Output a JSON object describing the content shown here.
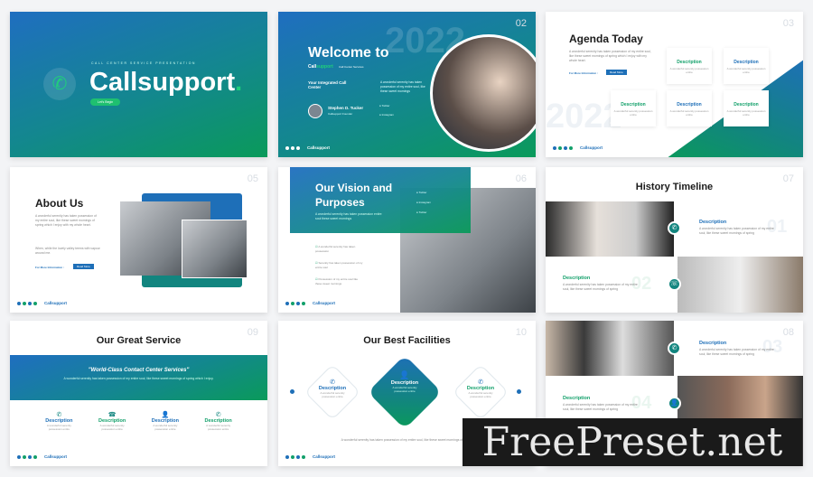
{
  "body_text": "A wonderful serenity has taken possession of my entire soul",
  "footer": {
    "logo": "Callsupport"
  },
  "s1": {
    "subtitle": "CALL CENTER SERVICE PRESENTATION",
    "title": "Callsupport",
    "dot": ".",
    "button": "Let's Begin",
    "icon": "phone-icon"
  },
  "s2": {
    "num": "02",
    "year": "2022",
    "title": "Welcome to",
    "brand_a": "Call",
    "brand_b": "support",
    "tag": "Call Center Services",
    "heading": "Your Integrated Call Center",
    "text": "A wonderful serenity has taken possession of my entire soul, like these sweet mornings",
    "person": "Stephen D. Tucker",
    "role": "Callsupport Founder",
    "social": [
      "Twitter",
      "Instagram"
    ]
  },
  "s3": {
    "num": "03",
    "title": "Agenda Today",
    "text": "A wonderful serenity has taken possession of my entire soul, like these sweet mornings of spring which I enjoy with my whole heart.",
    "link": "For More Information :",
    "button": "Read More",
    "year": "2022",
    "cards": [
      {
        "n": "01",
        "d": "Description"
      },
      {
        "n": "02",
        "d": "Description"
      },
      {
        "n": "03",
        "d": "Description"
      },
      {
        "n": "04",
        "d": "Description"
      },
      {
        "n": "05",
        "d": "Description"
      }
    ],
    "card_text": "A wonderful serenity possession entire"
  },
  "s5": {
    "num": "05",
    "title": "About Us",
    "text": "A wonderful serenity has taken possession of my entire soul, like these sweet mornings of spring which I enjoy with my whole heart.",
    "text2": "When, while the lovely valley teems with vapour around me.",
    "link": "For More Information :",
    "button": "Read More"
  },
  "s6": {
    "num": "06",
    "title": "Our Vision and Purposes",
    "text": "A wonderful serenity has taken possession entire soul these sweet mornings",
    "social": [
      "Twitter",
      "Instagram",
      "Twitter"
    ],
    "items": [
      "A wonderful serenity has taken possession",
      "Serenity has taken possession of my entire soul",
      "Possession of my entire soul like these sweet mornings"
    ]
  },
  "s7": {
    "num": "07",
    "title": "History Timeline",
    "items": [
      {
        "n": "01",
        "d": "Description"
      },
      {
        "n": "02",
        "d": "Description"
      }
    ],
    "text": "A wonderful serenity has taken possession of my entire soul, like these sweet mornings of spring"
  },
  "s8": {
    "num": "08",
    "items": [
      {
        "n": "03",
        "d": "Description"
      },
      {
        "n": "04",
        "d": "Description"
      }
    ],
    "text": "A wonderful serenity has taken possession of my entire soul, like these sweet mornings of spring"
  },
  "s9": {
    "num": "09",
    "title": "Our Great Service",
    "quote": "\"World-Class Contact Center Services\"",
    "text": "A wonderful serenity has taken possession of my entire soul, like these sweet mornings of spring which I enjoy.",
    "items": [
      {
        "d": "Description",
        "icon": "phone-icon"
      },
      {
        "d": "Description",
        "icon": "telephone-icon"
      },
      {
        "d": "Description",
        "icon": "agent-icon"
      },
      {
        "d": "Description",
        "icon": "phone-ring-icon"
      }
    ],
    "item_text": "A wonderful serenity possession entire"
  },
  "s10": {
    "num": "10",
    "title": "Our Best Facilities",
    "items": [
      {
        "d": "Description"
      },
      {
        "d": "Description"
      },
      {
        "d": "Description"
      }
    ],
    "item_text": "A wonderful serenity possession entire",
    "text": "A wonderful serenity has taken possession of my entire soul, like these sweet mornings of spring."
  },
  "watermark": "FreePreset.net",
  "colors": {
    "blue": "#1e6fb8",
    "green": "#12a06a",
    "teal": "#12857f"
  }
}
